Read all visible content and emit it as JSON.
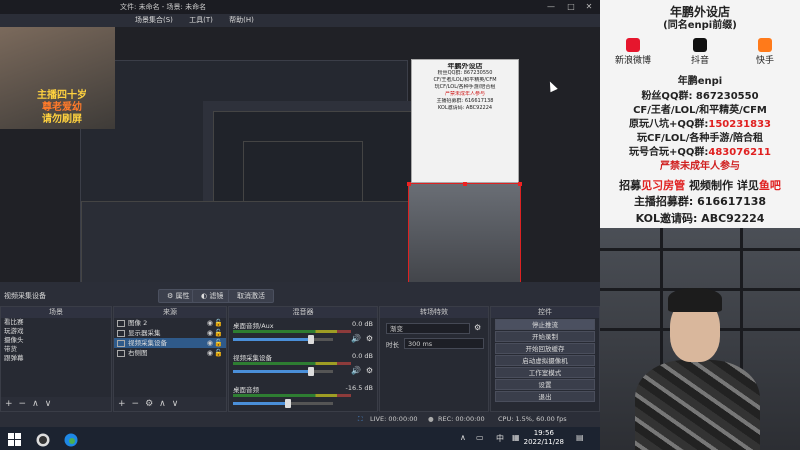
{
  "window": {
    "title": "文件: 未命名 - 场景: 未命名",
    "menu": [
      "场景集合(S)",
      "工具(T)",
      "帮助(H)"
    ]
  },
  "overlay": {
    "line1": "主播四十岁",
    "line2": "尊老爱幼",
    "line3": "请勿刷屏"
  },
  "source_bar": {
    "name": "视频采集设备",
    "properties": "属性",
    "filters": "滤镜",
    "deactivate": "取消激活"
  },
  "docks": {
    "scenes": {
      "title": "场景",
      "items": [
        "看比赛",
        "玩游戏",
        "摄像头",
        "带货",
        "跟弹幕"
      ]
    },
    "sources": {
      "title": "来源",
      "items": [
        "图像 2",
        "显示器采集",
        "视频采集设备",
        "右侧图"
      ]
    },
    "mixer": {
      "title": "混音器",
      "channels": [
        {
          "name": "桌面音频/Aux",
          "db": "0.0 dB",
          "level": 0.78
        },
        {
          "name": "视频采集设备",
          "db": "0.0 dB",
          "level": 0.78
        },
        {
          "name": "桌面音频",
          "db": "-16.5 dB",
          "level": 0.55
        }
      ]
    },
    "transitions": {
      "title": "转场特效",
      "type": "渐变",
      "duration_label": "时长",
      "duration": "300 ms"
    },
    "controls": {
      "title": "控件",
      "buttons": [
        "停止推流",
        "开始录制",
        "开始回放缓存",
        "启动虚拟摄像机",
        "工作室模式",
        "设置",
        "退出"
      ]
    }
  },
  "status": {
    "live": "LIVE: 00:00:00",
    "rec": "REC: 00:00:00",
    "cpu": "CPU: 1.5%, 60.00 fps"
  },
  "taskbar": {
    "ime": "中",
    "time": "19:56",
    "date": "2022/11/28"
  },
  "poster": {
    "title": "年鹏外设店",
    "subtitle": "(同名enpi前缀)",
    "socials": [
      "新浪微博",
      "抖音",
      "快手"
    ],
    "handle": "年鹏enpi",
    "fans": "粉丝QQ群: 867230550",
    "games": "CF/王者/LOL/和平精英/CFM",
    "group1_label": "原玩八坑+QQ群:",
    "group1_number": "150231833",
    "group2": "玩CF/LOL/各种手游/陪合租",
    "group3_label": "玩号合玩+QQ群:",
    "group3_number": "483076211",
    "minor": "严禁未成年人参与",
    "recruit_prefix": "招募",
    "recruit_red1": "见习房管",
    "recruit_mid": "视频制作",
    "recruit_mid2": "详见",
    "recruit_red2": "鱼吧",
    "anchor": "主播招募群: 616617138",
    "kol": "KOL邀请码: ABC92224"
  },
  "colors": {
    "obs_bg": "#2b2e38",
    "accent": "#2f5a8a",
    "poster_red": "#e02020",
    "overlay_yellow": "#ffd23f"
  }
}
